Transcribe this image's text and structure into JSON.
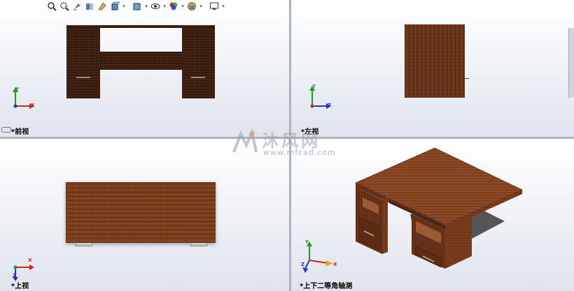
{
  "viewports": {
    "front": {
      "label": "*前视"
    },
    "left": {
      "label": "*左视"
    },
    "top": {
      "label": "*上视"
    },
    "iso": {
      "label": "*上下二等角轴测"
    }
  },
  "axes": {
    "x": "X",
    "y": "Y",
    "z": "Z"
  },
  "watermark": {
    "text": "沐风网",
    "url": "www.mfcad.com"
  },
  "toolbar": {
    "buttons": [
      "zoom-to-fit-icon",
      "zoom-area-icon",
      "previous-view-icon",
      "section-view-icon",
      "dynamic-annotation-icon",
      "view-orientation-icon",
      "display-style-icon",
      "hide-show-items-icon",
      "edit-appearance-icon",
      "apply-scene-icon",
      "view-settings-icon"
    ]
  },
  "colors": {
    "wood": "#6b3519",
    "wood_dark": "#3e1f10",
    "axis_x": "#cc2222",
    "axis_y": "#229922",
    "axis_z": "#2233cc"
  }
}
